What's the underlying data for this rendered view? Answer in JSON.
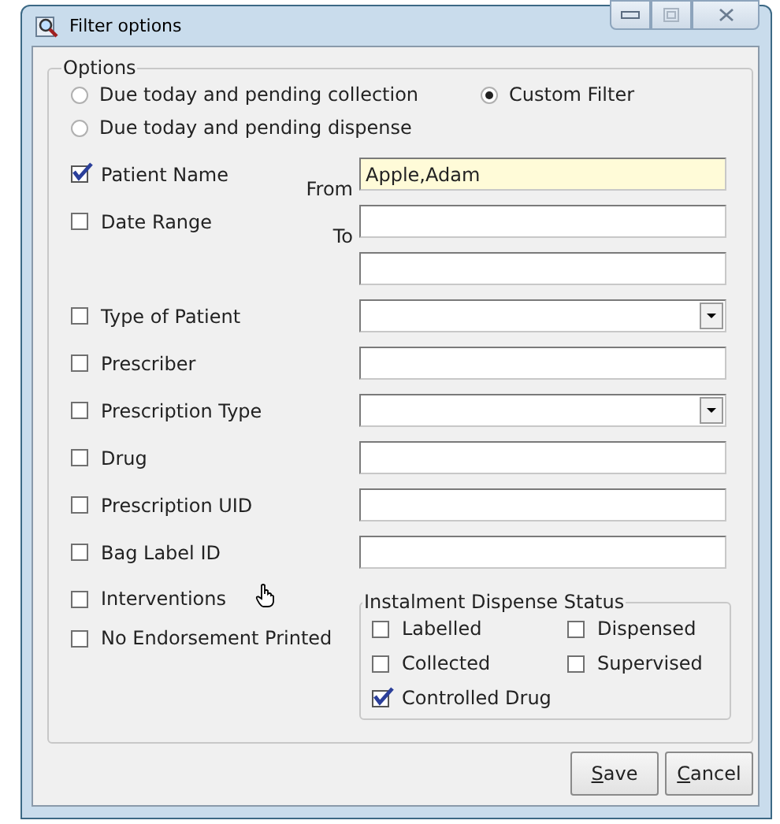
{
  "window": {
    "title": "Filter options"
  },
  "options": {
    "title": "Options",
    "radios": [
      {
        "label": "Due today and pending collection",
        "selected": false
      },
      {
        "label": "Custom Filter",
        "selected": true
      },
      {
        "label": "Due today and pending dispense",
        "selected": false
      }
    ],
    "filters": [
      {
        "kind": "text",
        "label": "Patient Name",
        "checked": true,
        "side_label": "From",
        "value": "Apple,Adam",
        "highlighted": true
      },
      {
        "kind": "range",
        "label": "Date Range",
        "checked": false,
        "side_label": "To"
      },
      {
        "kind": "combo",
        "label": "Type of Patient",
        "checked": false
      },
      {
        "kind": "text",
        "label": "Prescriber",
        "checked": false
      },
      {
        "kind": "combo",
        "label": "Prescription Type",
        "checked": false
      },
      {
        "kind": "text",
        "label": "Drug",
        "checked": false
      },
      {
        "kind": "text",
        "label": "Prescription UID",
        "checked": false
      },
      {
        "kind": "text",
        "label": "Bag Label ID",
        "checked": false
      },
      {
        "kind": "plain",
        "label": "Interventions",
        "checked": false,
        "cursor": true
      },
      {
        "kind": "plain",
        "label": "No Endorsement Printed",
        "checked": false
      }
    ],
    "instalment": {
      "title": "Instalment Dispense Status",
      "items": [
        {
          "label": "Labelled",
          "checked": false
        },
        {
          "label": "Dispensed",
          "checked": false
        },
        {
          "label": "Collected",
          "checked": false
        },
        {
          "label": "Supervised",
          "checked": false
        },
        {
          "label": "Controlled Drug",
          "checked": true
        }
      ]
    }
  },
  "buttons": [
    {
      "key": "S",
      "rest": "ave"
    },
    {
      "key": "C",
      "rest": "ancel"
    }
  ]
}
